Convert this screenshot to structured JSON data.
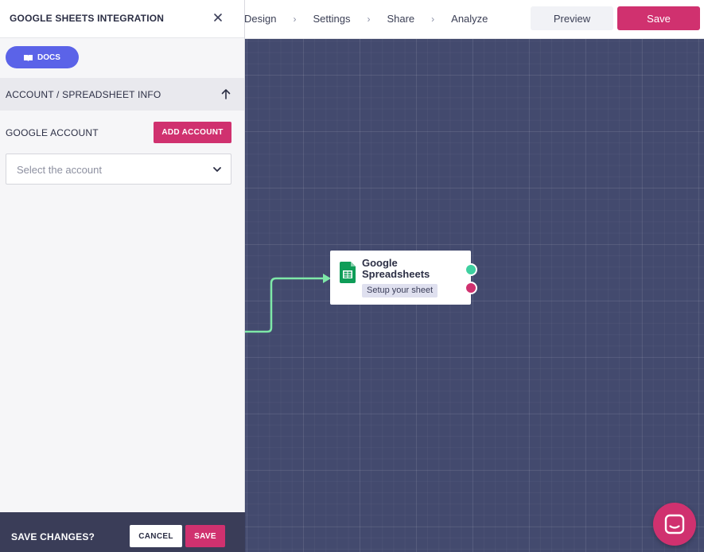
{
  "topbar": {
    "breadcrumbs": [
      "Design",
      "Settings",
      "Share",
      "Analyze"
    ],
    "separator": "›",
    "preview_label": "Preview",
    "save_label": "Save"
  },
  "panel": {
    "title": "GOOGLE SHEETS INTEGRATION",
    "docs_label": "DOCS",
    "section_title": "ACCOUNT / SPREADSHEET INFO",
    "account_label": "GOOGLE ACCOUNT",
    "add_account_label": "ADD ACCOUNT",
    "select_placeholder": "Select the account"
  },
  "footer": {
    "label": "SAVE CHANGES?",
    "cancel_label": "CANCEL",
    "save_label": "SAVE"
  },
  "node": {
    "title": "Google Spreadsheets",
    "badge": "Setup your sheet"
  },
  "colors": {
    "accent_pink": "#d0316f",
    "docs_blue": "#5b63e8",
    "canvas": "#434a6e",
    "port_green": "#3fd0a0",
    "connector_green": "#7ee8a8",
    "sheets_green": "#0f9d58"
  },
  "icons": {
    "close": "close-icon",
    "docs": "book-icon",
    "collapse": "arrow-up-icon",
    "dropdown": "chevron-down-icon",
    "node": "google-sheets-icon",
    "chat": "chat-icon"
  }
}
